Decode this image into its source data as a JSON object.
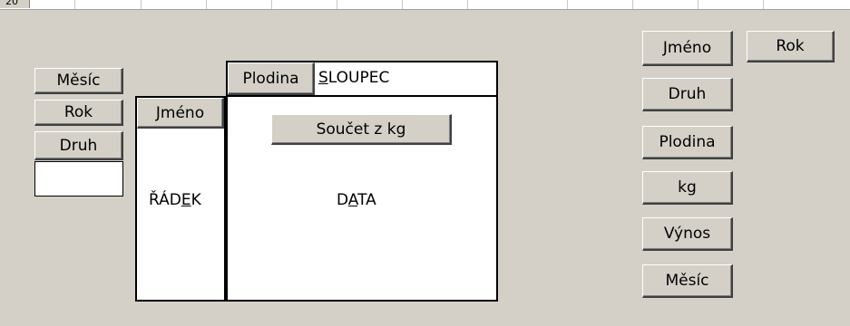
{
  "sheet": {
    "row_number": "20"
  },
  "layout": {
    "page_fields": [
      "Měsíc",
      "Rok",
      "Druh"
    ],
    "row_area": {
      "field": "Jméno",
      "hint_prefix": "ŘÁD",
      "hint_key": "E",
      "hint_suffix": "K"
    },
    "column_area": {
      "field": "Plodina",
      "hint_key": "S",
      "hint_suffix": "LOUPEC"
    },
    "data_area": {
      "field": "Součet z kg",
      "hint_prefix": "D",
      "hint_key": "A",
      "hint_suffix": "TA"
    }
  },
  "field_list": [
    "Jméno",
    "Rok",
    "Druh",
    "Plodina",
    "kg",
    "Výnos",
    "Měsíc"
  ]
}
